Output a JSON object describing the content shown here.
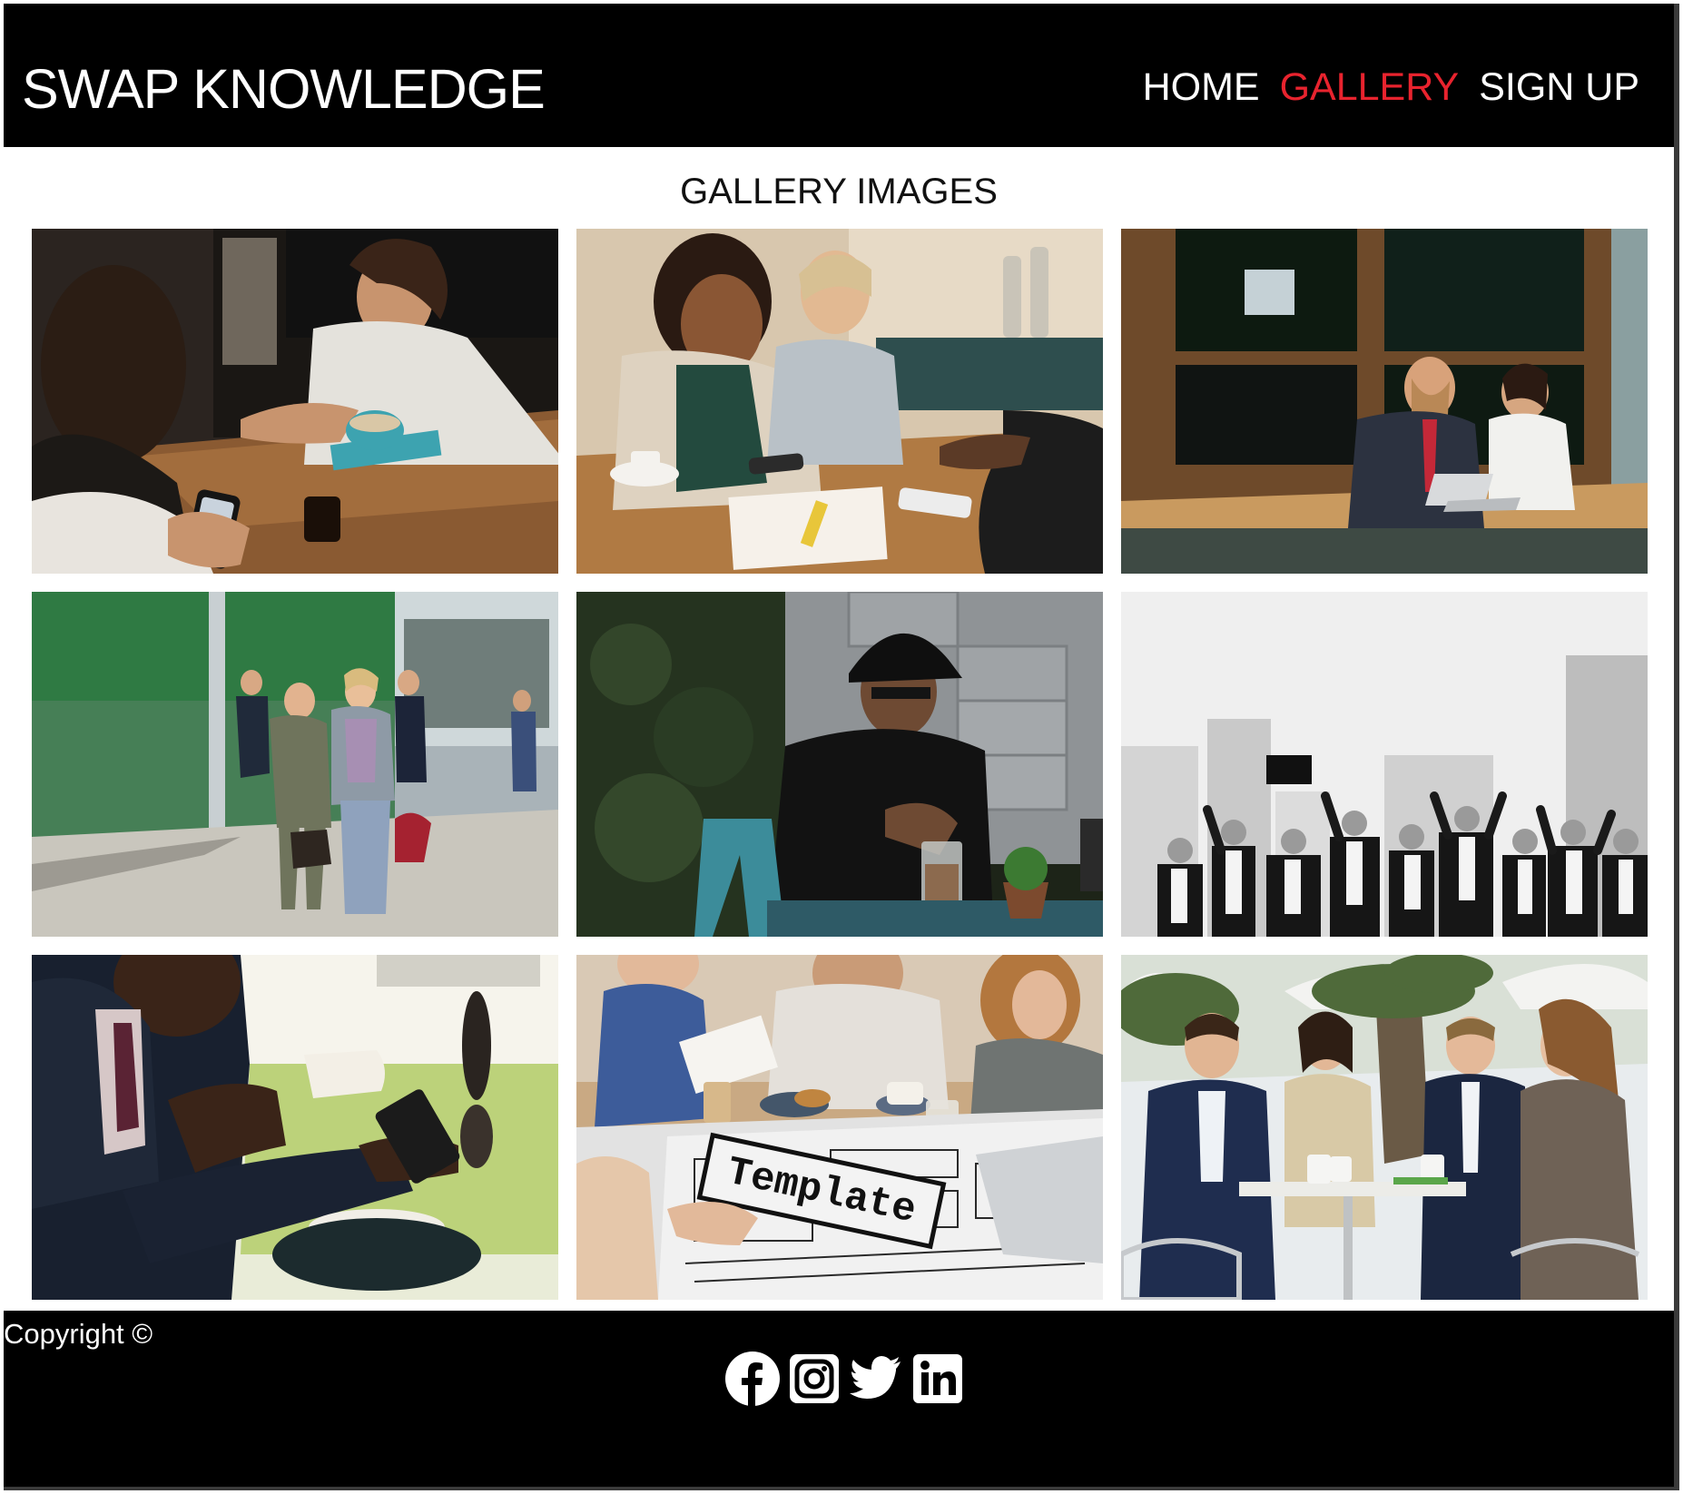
{
  "header": {
    "brand": "SWAP KNOWLEDGE",
    "nav": [
      {
        "label": "HOME",
        "active": false
      },
      {
        "label": "GALLERY",
        "active": true
      },
      {
        "label": "SIGN UP",
        "active": false
      }
    ]
  },
  "main": {
    "title": "GALLERY IMAGES",
    "images": [
      {
        "subject": "woman-smiling-cafe-man-phone",
        "icon": "photo"
      },
      {
        "subject": "two-women-laughing-meeting",
        "icon": "photo"
      },
      {
        "subject": "couple-laptop-cafe-window",
        "icon": "photo"
      },
      {
        "subject": "business-people-walking-street",
        "icon": "photo"
      },
      {
        "subject": "man-cap-drinking-coffee",
        "icon": "photo"
      },
      {
        "subject": "business-team-celebrating-city",
        "icon": "photo"
      },
      {
        "subject": "businessman-coffee-phone",
        "icon": "photo"
      },
      {
        "subject": "team-meeting-template-sketch",
        "icon": "photo"
      },
      {
        "subject": "four-people-outdoor-cafe",
        "icon": "photo"
      }
    ],
    "template_overlay_text": "Template"
  },
  "footer": {
    "copyright": "Copyright ©",
    "social": [
      {
        "name": "facebook-icon"
      },
      {
        "name": "instagram-icon"
      },
      {
        "name": "twitter-icon"
      },
      {
        "name": "linkedin-icon"
      }
    ]
  },
  "colors": {
    "header_bg": "#000000",
    "footer_bg": "#000000",
    "active_nav": "#e8232e",
    "text_light": "#ffffff"
  }
}
